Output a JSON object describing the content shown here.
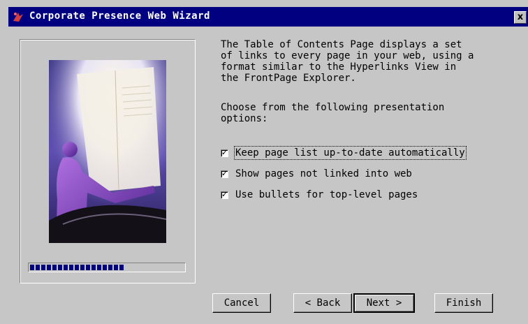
{
  "window": {
    "title": "Corporate Presence Web Wizard",
    "close_glyph": "x",
    "app_icon": "wizard-icon"
  },
  "description": "The Table of Contents Page displays a set\nof links to every page in your web, using a\nformat similar to the Hyperlinks View in\nthe FrontPage Explorer.",
  "options_label": "Choose from the following presentation\noptions:",
  "options": [
    {
      "label": "Keep page list up-to-date automatically",
      "checked": true
    },
    {
      "label": "Show pages not linked into web",
      "checked": true
    },
    {
      "label": "Use bullets for top-level pages",
      "checked": true
    }
  ],
  "progress": {
    "value": 0.62
  },
  "buttons": {
    "cancel": "Cancel",
    "back": "< Back",
    "next": "Next >",
    "finish": "Finish"
  },
  "colors": {
    "titlebar": "#000080",
    "face": "#c6c6c6",
    "progress": "#000080"
  }
}
